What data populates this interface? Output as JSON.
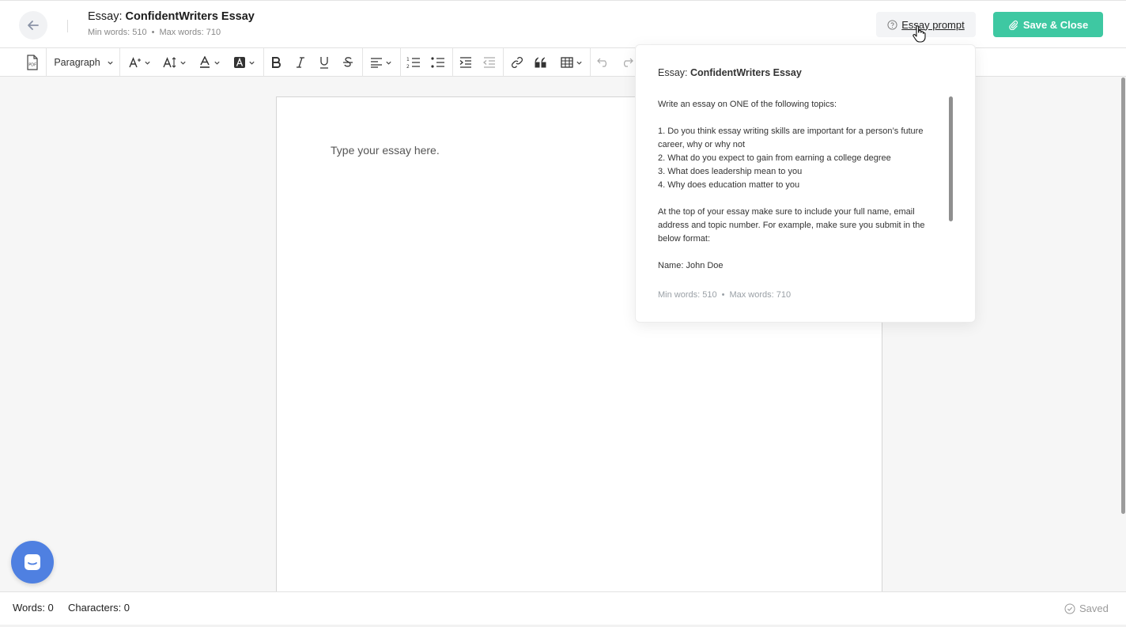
{
  "header": {
    "title_prefix": "Essay: ",
    "title_name": "ConfidentWriters Essay",
    "min_words": "Min words: 510",
    "separator": "•",
    "max_words": "Max words: 710",
    "prompt_button": "Essay prompt",
    "save_button": "Save & Close",
    "save_color": "#3ec8a2"
  },
  "toolbar": {
    "paragraph_label": "Paragraph",
    "pdf_label": "PDF",
    "icons": [
      "pdf-icon",
      "font-size-icon",
      "text-height-icon",
      "font-color-icon",
      "highlight-icon",
      "bold-icon",
      "italic-icon",
      "underline-icon",
      "strikethrough-icon",
      "align-icon",
      "numbered-list-icon",
      "bulleted-list-icon",
      "indent-icon",
      "outdent-icon",
      "link-icon",
      "quote-icon",
      "table-icon",
      "undo-icon",
      "redo-icon"
    ]
  },
  "editor": {
    "placeholder": "Type your essay here."
  },
  "popover": {
    "title_prefix": "Essay: ",
    "title_name": "ConfidentWriters Essay",
    "intro": "Write an essay on ONE of the following topics:",
    "topics": [
      "1. Do you think essay writing skills are important for a person’s future career, why or why not",
      "2. What do you expect to gain from earning a college degree",
      "3. What does leadership mean to you",
      "4. Why does education matter to you"
    ],
    "instructions": "At the top of your essay make sure to include your full name, email address and topic number. For example, make sure you submit in the below format:",
    "example": "Name: John Doe",
    "min_words": "Min words: 510",
    "separator": "•",
    "max_words": "Max words: 710"
  },
  "footer": {
    "words": "Words: 0",
    "characters": "Characters: 0",
    "status": "Saved"
  }
}
